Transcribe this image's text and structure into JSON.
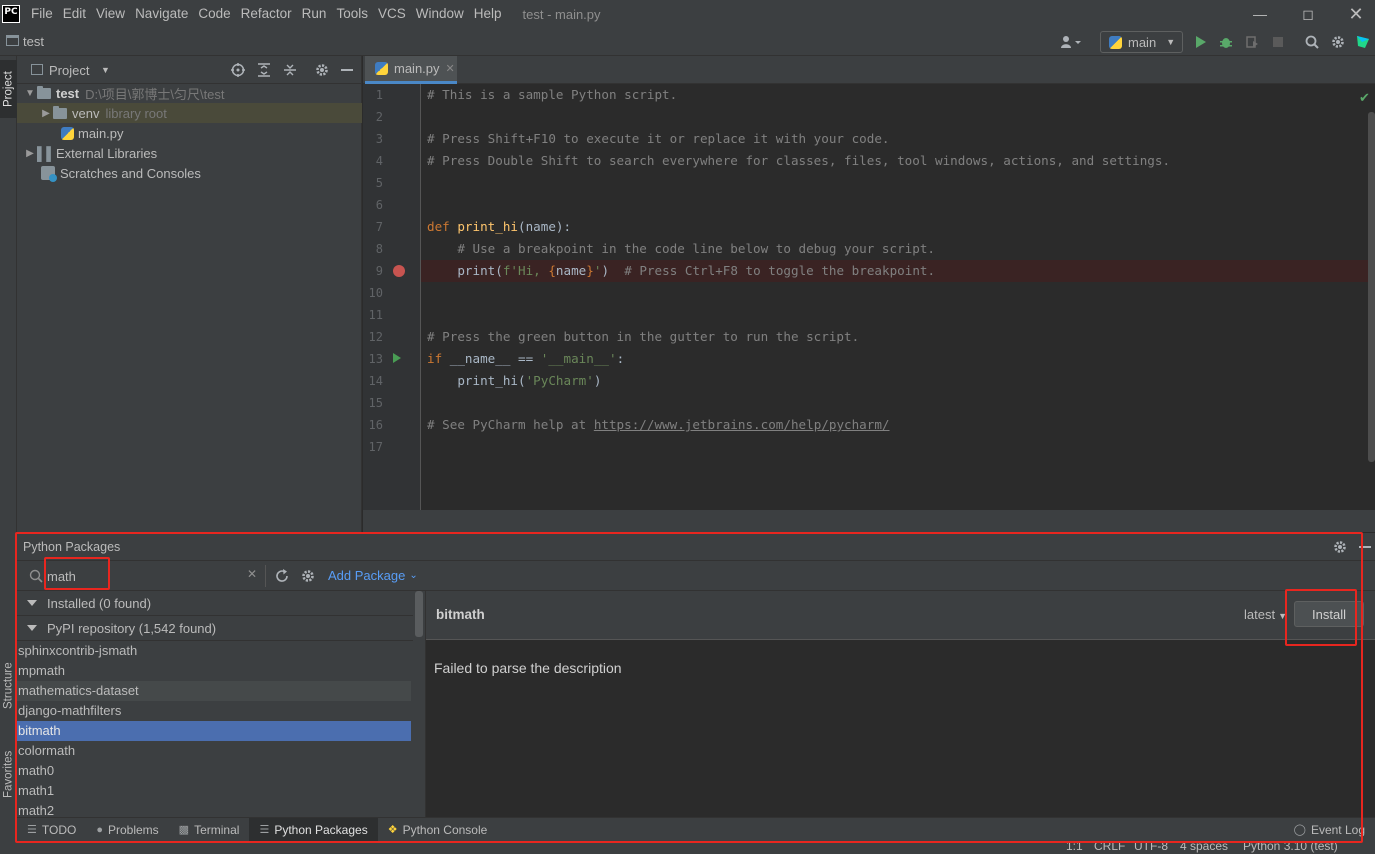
{
  "app": {
    "logo_text": "PC",
    "window_title": "test - main.py",
    "menu": [
      "File",
      "Edit",
      "View",
      "Navigate",
      "Code",
      "Refactor",
      "Run",
      "Tools",
      "VCS",
      "Window",
      "Help"
    ]
  },
  "navbar": {
    "project_name": "test",
    "run_config": "main"
  },
  "left_strip": {
    "project_tab": "Project",
    "structure_tab": "Structure",
    "favorites_tab": "Favorites"
  },
  "project": {
    "header": "Project",
    "tree": [
      {
        "label": "test",
        "hint": "D:\\项目\\郭博士\\匀尺\\test"
      },
      {
        "label": "venv",
        "hint": "library root"
      },
      {
        "label": "main.py",
        "hint": ""
      },
      {
        "label": "External Libraries",
        "hint": ""
      },
      {
        "label": "Scratches and Consoles",
        "hint": ""
      }
    ]
  },
  "editor": {
    "tab": "main.py",
    "line_numbers": [
      "1",
      "2",
      "3",
      "4",
      "5",
      "6",
      "7",
      "8",
      "9",
      "10",
      "11",
      "12",
      "13",
      "14",
      "15",
      "16",
      "17"
    ],
    "lines": {
      "l1": "# This is a sample Python script.",
      "l3": "# Press Shift+F10 to execute it or replace it with your code.",
      "l4": "# Press Double Shift to search everywhere for classes, files, tool windows, actions, and settings.",
      "l7_kw": "def ",
      "l7_fn": "print_hi",
      "l7_rest": "(name):",
      "l8": "    # Use a breakpoint in the code line below to debug your script.",
      "l9_a": "    print(",
      "l9_str1": "f'Hi, ",
      "l9_lb": "{",
      "l9_var": "name",
      "l9_rb": "}",
      "l9_str2": "'",
      "l9_b": ")  ",
      "l9_comment": "# Press Ctrl+F8 to toggle the breakpoint.",
      "l12": "# Press the green button in the gutter to run the script.",
      "l13_kw": "if ",
      "l13_mid": "__name__ == ",
      "l13_str": "'__main__'",
      "l13_end": ":",
      "l14_a": "    print_hi(",
      "l14_str": "'PyCharm'",
      "l14_b": ")",
      "l16_a": "# See PyCharm help at ",
      "l16_link": "https://www.jetbrains.com/help/pycharm/"
    }
  },
  "packages": {
    "title": "Python Packages",
    "search_value": "math",
    "add_package": "Add Package",
    "installed_group": "Installed (0 found)",
    "pypi_group": "PyPI repository (1,542 found)",
    "items": [
      "sphinxcontrib-jsmath",
      "mpmath",
      "mathematics-dataset",
      "django-mathfilters",
      "bitmath",
      "colormath",
      "math0",
      "math1",
      "math2"
    ],
    "selected": {
      "name": "bitmath",
      "version": "latest",
      "install_label": "Install",
      "description": "Failed to parse the description"
    }
  },
  "bottom_tabs": [
    "TODO",
    "Problems",
    "Terminal",
    "Python Packages",
    "Python Console"
  ],
  "event_log": "Event Log",
  "status": {
    "position": "1:1",
    "line_sep": "CRLF",
    "encoding": "UTF-8",
    "indent": "4 spaces",
    "interpreter": "Python 3.10 (test)"
  }
}
